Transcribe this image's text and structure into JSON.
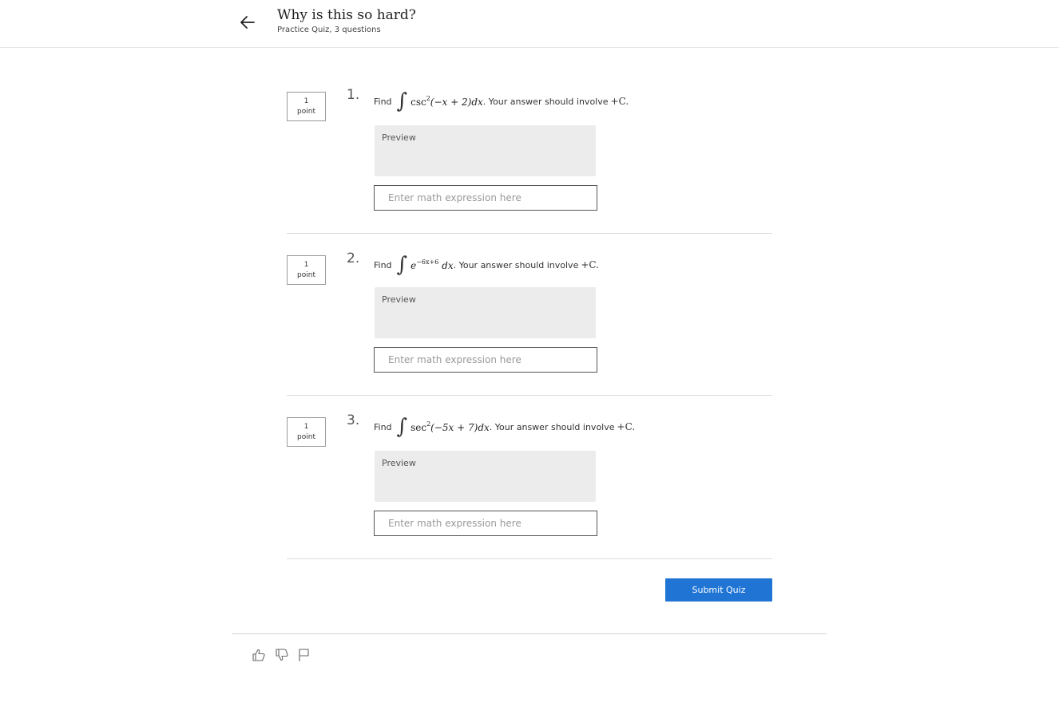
{
  "header": {
    "title": "Why is this so hard?",
    "subtitle": "Practice Quiz, 3 questions"
  },
  "questions": [
    {
      "number": "1.",
      "points_value": "1",
      "points_label": "point",
      "prefix": "Find",
      "expr_func": "csc",
      "expr_power": "2",
      "expr_arg": "(−x + 2)",
      "expr_dx": "dx",
      "suffix": ". Your answer should involve",
      "constant": "+C.",
      "preview_label": "Preview",
      "input_placeholder": "Enter math expression here",
      "input_value": ""
    },
    {
      "number": "2.",
      "points_value": "1",
      "points_label": "point",
      "prefix": "Find",
      "expr_func": "e",
      "expr_power": "−6x+6",
      "expr_arg": "",
      "expr_dx": "dx",
      "suffix": ". Your answer should involve",
      "constant": "+C.",
      "preview_label": "Preview",
      "input_placeholder": "Enter math expression here",
      "input_value": ""
    },
    {
      "number": "3.",
      "points_value": "1",
      "points_label": "point",
      "prefix": "Find",
      "expr_func": "sec",
      "expr_power": "2",
      "expr_arg": "(−5x + 7)",
      "expr_dx": "dx",
      "suffix": ". Your answer should involve",
      "constant": "+C.",
      "preview_label": "Preview",
      "input_placeholder": "Enter math expression here",
      "input_value": ""
    }
  ],
  "submit": {
    "label": "Submit Quiz"
  },
  "footer": {
    "icons": [
      "thumbs-up-icon",
      "thumbs-down-icon",
      "flag-icon"
    ]
  },
  "colors": {
    "accent": "#1f74d4",
    "preview_bg": "#ececec",
    "divider": "#dcdcdc"
  }
}
